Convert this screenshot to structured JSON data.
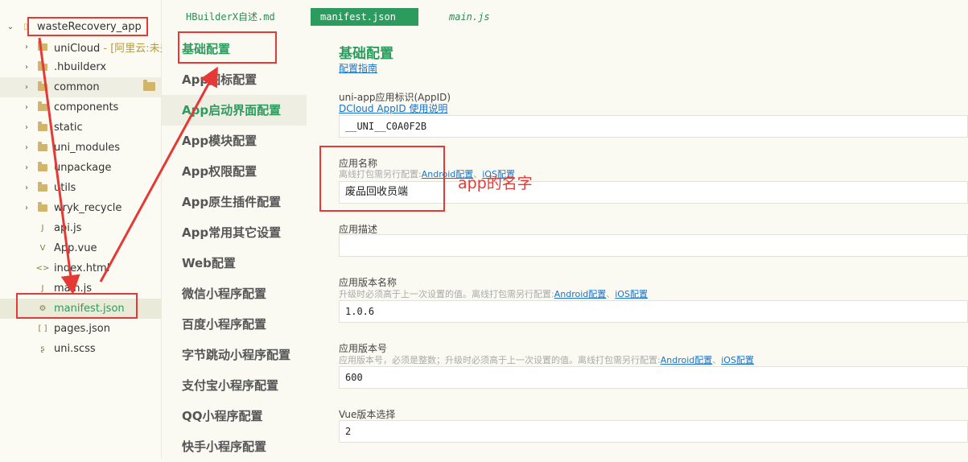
{
  "explorer": {
    "root": "wasteRecovery_app",
    "items": [
      {
        "label": "uniCloud",
        "suffix": "- [阿里云:未关"
      },
      {
        "label": ".hbuilderx"
      },
      {
        "label": "common"
      },
      {
        "label": "components"
      },
      {
        "label": "static"
      },
      {
        "label": "uni_modules"
      },
      {
        "label": "unpackage"
      },
      {
        "label": "utils"
      },
      {
        "label": "wryk_recycle"
      },
      {
        "label": "api.js"
      },
      {
        "label": "App.vue"
      },
      {
        "label": "index.html"
      },
      {
        "label": "main.js"
      },
      {
        "label": "manifest.json"
      },
      {
        "label": "pages.json"
      },
      {
        "label": "uni.scss"
      }
    ]
  },
  "tabs": [
    "HBuilderX自述.md",
    "manifest.json",
    "main.js"
  ],
  "menu": [
    "基础配置",
    "App图标配置",
    "App启动界面配置",
    "App模块配置",
    "App权限配置",
    "App原生插件配置",
    "App常用其它设置",
    "Web配置",
    "微信小程序配置",
    "百度小程序配置",
    "字节跳动小程序配置",
    "支付宝小程序配置",
    "QQ小程序配置",
    "快手小程序配置"
  ],
  "form": {
    "title": "基础配置",
    "guide_link": "配置指南",
    "appid": {
      "label": "uni-app应用标识(AppID)",
      "link": "DCloud AppID 使用说明",
      "value": "__UNI__C0A0F2B"
    },
    "name": {
      "label": "应用名称",
      "hint": "离线打包需另行配置:",
      "android": "Android配置",
      "sep": "、",
      "ios": "iOS配置",
      "value": "废品回收员端"
    },
    "desc": {
      "label": "应用描述",
      "value": ""
    },
    "version_name": {
      "label": "应用版本名称",
      "hint": "升级时必须高于上一次设置的值。离线打包需另行配置:",
      "android": "Android配置",
      "sep": "、",
      "ios": "iOS配置",
      "value": "1.0.6"
    },
    "version_code": {
      "label": "应用版本号",
      "hint": "应用版本号，必须是整数；升级时必须高于上一次设置的值。离线打包需另行配置:",
      "android": "Android配置",
      "sep": "、",
      "ios": "iOS配置",
      "value": "600"
    },
    "vue": {
      "label": "Vue版本选择",
      "value": "2"
    }
  },
  "annotation": {
    "text": "app的名字",
    "color": "#e53935"
  },
  "colors": {
    "accent": "#2c9c5e",
    "link": "#1a73c9",
    "annotation": "#e53935"
  }
}
